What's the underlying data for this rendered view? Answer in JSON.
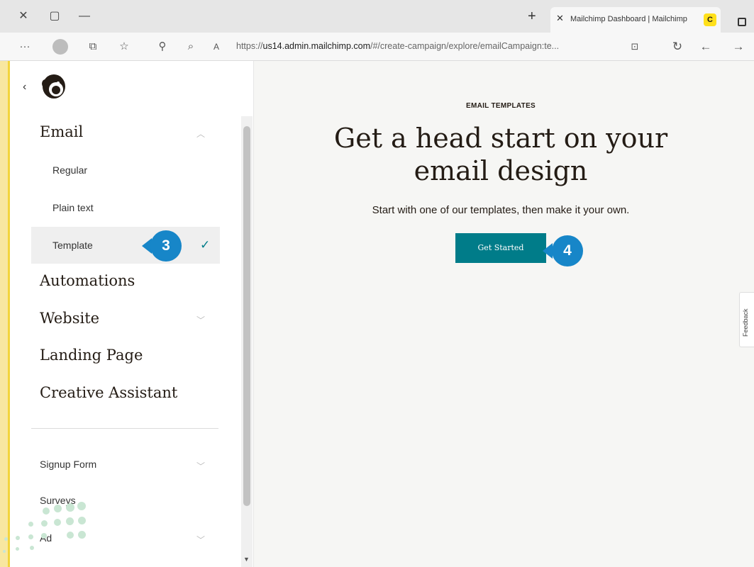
{
  "browser": {
    "tab_title": "Mailchimp Dashboard | Mailchimp",
    "url_prefix": "https://",
    "url_domain": "us14.admin.mailchimp.com",
    "url_path": "/#/create-campaign/explore/emailCampaign:te...",
    "favicon_letter": "C",
    "icons": [
      "close-icon",
      "minimize-icon",
      "maximize-icon",
      "new-tab-icon",
      "more-icon",
      "profile-icon",
      "collections-icon",
      "favorites-icon",
      "extensions-icon",
      "zoom-icon",
      "read-aloud-icon",
      "refresh-icon",
      "back-icon",
      "forward-icon",
      "lock-icon"
    ]
  },
  "sidebar": {
    "sections": [
      {
        "label": "Email",
        "children": [
          {
            "label": "Regular"
          },
          {
            "label": "Plain text"
          },
          {
            "label": "Template",
            "selected": true
          }
        ]
      },
      {
        "label": "Automations"
      },
      {
        "label": "Website"
      },
      {
        "label": "Landing Page"
      },
      {
        "label": "Creative Assistant"
      }
    ],
    "secondary": [
      {
        "label": "Signup Form"
      },
      {
        "label": "Surveys"
      },
      {
        "label": "Ad"
      }
    ]
  },
  "main": {
    "eyebrow": "EMAIL TEMPLATES",
    "headline_line1": "Get a head start on your",
    "headline_line2": "email design",
    "subtitle": "Start with one of our templates, then make it your own.",
    "cta_label": "Get Started",
    "feedback_label": "Feedback"
  },
  "annotations": {
    "step_template": "3",
    "step_get_started": "4"
  },
  "colors": {
    "accent": "#007c89",
    "badge": "#1786c8",
    "brand_yellow": "#ffe01b"
  }
}
